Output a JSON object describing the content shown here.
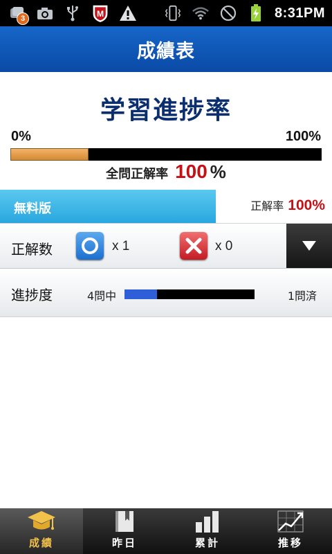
{
  "status_bar": {
    "notification_count": "3",
    "time": "8:31PM",
    "icons": [
      "notification-badge-icon",
      "camera-icon",
      "usb-icon",
      "mcafee-shield-icon",
      "warning-icon",
      "vibrate-icon",
      "wifi-icon",
      "no-signal-icon",
      "battery-charging-icon"
    ]
  },
  "header": {
    "title": "成績表"
  },
  "progress": {
    "heading": "学習進捗率",
    "min_label": "0%",
    "max_label": "100%",
    "fill_fraction": 0.25,
    "accuracy_label": "全問正解率",
    "accuracy_value": "100",
    "accuracy_unit": "%"
  },
  "free_band": {
    "label": "無料版",
    "rate_label": "正解率",
    "rate_value": "100%"
  },
  "correct_row": {
    "label": "正解数",
    "correct_count": "x 1",
    "wrong_count": "x 0"
  },
  "progress_row": {
    "label": "進捗度",
    "total": "4問中",
    "done": "1問済",
    "fill_fraction": 0.25
  },
  "tabs": [
    {
      "label": "成績",
      "icon": "graduation-cap-icon",
      "active": true
    },
    {
      "label": "昨日",
      "icon": "book-icon",
      "active": false
    },
    {
      "label": "累計",
      "icon": "bar-chart-icon",
      "active": false
    },
    {
      "label": "推移",
      "icon": "trend-chart-icon",
      "active": false
    }
  ],
  "colors": {
    "title_bar": "#0a4aa6",
    "progress_fill": "#d48a32",
    "accent_red": "#c61015",
    "free_band": "#2aa7df",
    "question_fill": "#2f5fd8",
    "active_tab_label": "#f0c04a"
  }
}
